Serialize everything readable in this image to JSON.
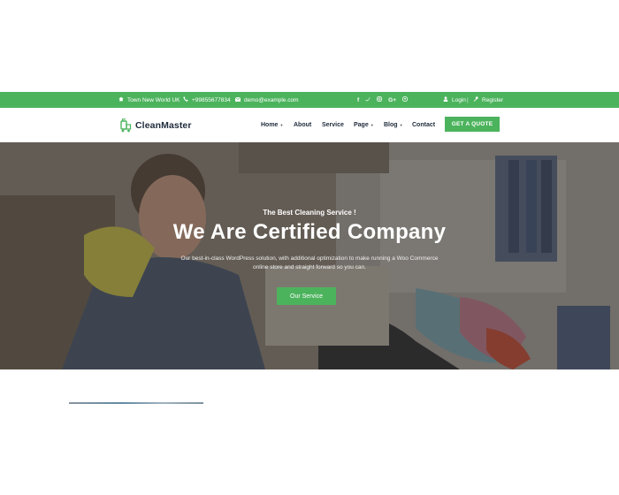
{
  "topbar": {
    "location": "Town New World UK",
    "phone": "+99855677834",
    "email": "demo@example.com",
    "social": [
      "f",
      "t",
      "ig",
      "G+",
      "p"
    ],
    "login": "Login",
    "separator": "|",
    "register": "Register"
  },
  "brand": {
    "name": "CleanMaster"
  },
  "nav": {
    "items": [
      {
        "label": "Home",
        "dropdown": true
      },
      {
        "label": "About",
        "dropdown": false
      },
      {
        "label": "Service",
        "dropdown": false
      },
      {
        "label": "Page",
        "dropdown": true
      },
      {
        "label": "Blog",
        "dropdown": true
      },
      {
        "label": "Contact",
        "dropdown": false
      }
    ],
    "cta": "GET A QUOTE"
  },
  "hero": {
    "subtitle": "The Best Cleaning Service !",
    "title": "We Are Certified Company",
    "description": "Our best-in-class WordPress solution, with additional optimization to make running a Woo Commerce online store and straight forward so you can.",
    "button": "Our Service"
  },
  "colors": {
    "accent": "#4cb35d",
    "text_dark": "#1e2a3a"
  }
}
